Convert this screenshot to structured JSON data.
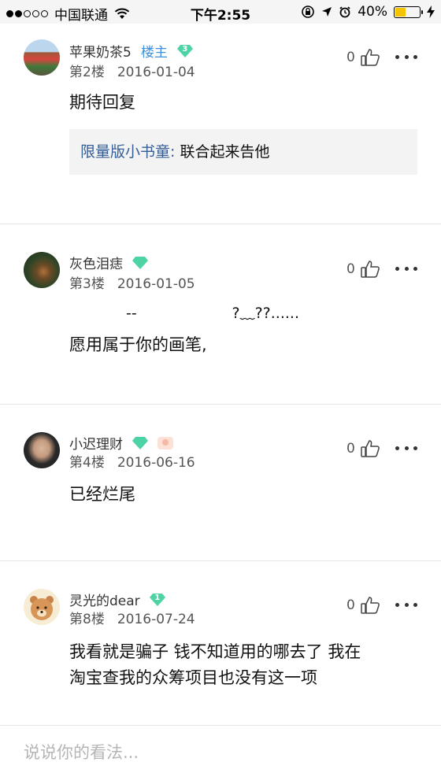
{
  "status_bar": {
    "carrier": "中国联通",
    "time": "下午2:55",
    "battery": "40%",
    "battery_level": 0.4
  },
  "comments": [
    {
      "username": "苹果奶茶5",
      "host_tag": "楼主",
      "level": "3",
      "floor": "第2楼",
      "date": "2016-01-04",
      "likes": "0",
      "text": "期待回复",
      "quote": {
        "name": "限量版小书童:",
        "text": " 联合起来告他"
      }
    },
    {
      "username": "灰色泪痣",
      "level": "",
      "floor": "第3楼",
      "date": "2016-01-05",
      "likes": "0",
      "text_line1": "--                    ?﹏??......",
      "text_line2": "愿用属于你的画笔,"
    },
    {
      "username": "小迟理财",
      "level": "",
      "floor": "第4楼",
      "date": "2016-06-16",
      "likes": "0",
      "text": "已经烂尾"
    },
    {
      "username": "灵光的dear",
      "level": "1",
      "floor": "第8楼",
      "date": "2016-07-24",
      "likes": "0",
      "text_line1": "我看就是骗子 钱不知道用的哪去了 我在",
      "text_line2": "淘宝查我的众筹项目也没有这一项"
    }
  ],
  "input": {
    "placeholder": "说说你的看法..."
  },
  "colors": {
    "accent": "#3d8fe0",
    "gem": "#4ed3a4",
    "quote_name": "#355e96"
  }
}
